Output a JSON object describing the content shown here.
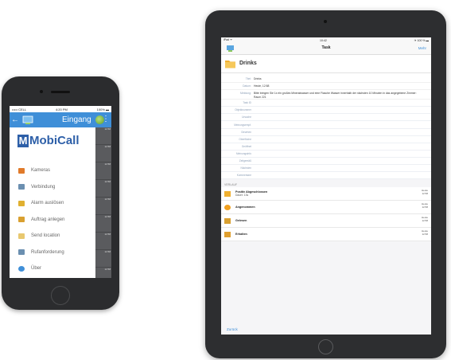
{
  "phone": {
    "status": {
      "carrier": "••••• CELL ",
      "time": "4:20 PM",
      "battery": "100% ▬"
    },
    "appbar": {
      "back": "←",
      "title": "Eingang",
      "more": "⋮"
    },
    "brand": {
      "letter": "M",
      "name": "MobiCall"
    },
    "menu": [
      {
        "label": "Kameras",
        "icon": "camera-icon",
        "color": "#e07a2a"
      },
      {
        "label": "Verbindung",
        "icon": "connection-icon",
        "color": "#6b8fb0"
      },
      {
        "label": "Alarm auslösen",
        "icon": "alarm-icon",
        "color": "#e0b030"
      },
      {
        "label": "Auftrag anlegen",
        "icon": "task-icon",
        "color": "#d9a030"
      },
      {
        "label": "Send location",
        "icon": "location-icon",
        "color": "#e8c870"
      },
      {
        "label": "Rufanforderung",
        "icon": "call-request-icon",
        "color": "#6b8fb0"
      },
      {
        "label": "Über",
        "icon": "info-icon",
        "color": "#3f8fd8"
      }
    ],
    "side_times": [
      "12:58",
      "12:58",
      "12:58",
      "12:58",
      "12:58",
      "12:58",
      "12:58",
      "12:58",
      "12:58"
    ]
  },
  "ipad": {
    "status": {
      "left": "iPad ᯤ",
      "time": "10:42",
      "right": "✈ 100 % ▬"
    },
    "nav": {
      "title": "Task",
      "more": "Mehr"
    },
    "task": {
      "name": "Drinks"
    },
    "fields": [
      {
        "label": "Titel:",
        "value": "Drinks"
      },
      {
        "label": "Datum:",
        "value": "Heute, 12:58"
      },
      {
        "label": "Meldung:",
        "value": "Bitte bringen Sie 1x ein großes Mineralwasser und eine Flasche Wasser innerhalb der nächsten 10 Minuten in das angegebene Zimmer: Raum 221"
      }
    ],
    "empty_fields": [
      "Task ID",
      "Objektnummer",
      "Ursache",
      "Meinungsempf.",
      "Gesehen",
      "Oberfläche",
      "Geöffnet",
      "Meinungsinfo",
      "Zeitgemäß",
      "Nächsten",
      "Kommentare"
    ],
    "section": "VERLAUF",
    "log": [
      {
        "title": "Positiv Abgeschlossen",
        "sub": "Dauer: 13s",
        "date": "Heute",
        "time": "12:58",
        "icon": "folder-icon",
        "color": "#f0b030"
      },
      {
        "title": "Angenommen",
        "sub": "",
        "date": "Heute",
        "time": "12:58",
        "icon": "accepted-icon",
        "color": "#f0a020"
      },
      {
        "title": "Gelesen",
        "sub": "",
        "date": "Heute",
        "time": "12:58",
        "icon": "read-icon",
        "color": "#d9a030"
      },
      {
        "title": "Erhalten",
        "sub": "",
        "date": "Heute",
        "time": "12:58",
        "icon": "received-icon",
        "color": "#e0a030"
      }
    ],
    "back": "Zurück"
  }
}
